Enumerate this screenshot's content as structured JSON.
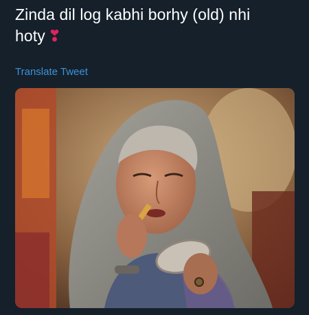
{
  "tweet": {
    "text_line1": "Zinda dil log kabhi borhy (old) nhi",
    "text_line2": "hoty",
    "emoji": "❣",
    "translate_label": "Translate Tweet"
  },
  "media": {
    "icon": "photo"
  },
  "colors": {
    "background": "#15202b",
    "text": "#ffffff",
    "link": "#3b94d9",
    "emoji": "#e0245e"
  }
}
